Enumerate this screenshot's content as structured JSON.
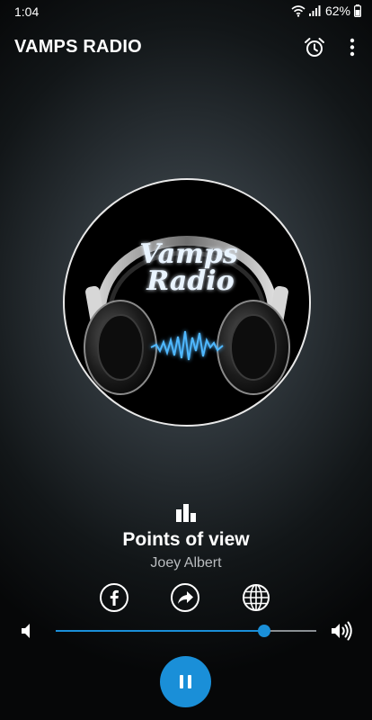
{
  "status_bar": {
    "time": "1:04",
    "battery": "62%"
  },
  "app_bar": {
    "title": "VAMPS RADIO"
  },
  "logo": {
    "line1": "Vamps",
    "line2": "Radio"
  },
  "track": {
    "title": "Points of view",
    "artist": "Joey Albert"
  },
  "volume": {
    "level": 0.8
  },
  "colors": {
    "accent": "#1a8fd8",
    "background": "#121618"
  },
  "icons": [
    "wifi-icon",
    "signal-icon",
    "battery-icon",
    "alarm-icon",
    "more-icon",
    "equalizer-icon",
    "facebook-icon",
    "share-icon",
    "globe-icon",
    "volume-low-icon",
    "volume-high-icon",
    "pause-icon"
  ]
}
